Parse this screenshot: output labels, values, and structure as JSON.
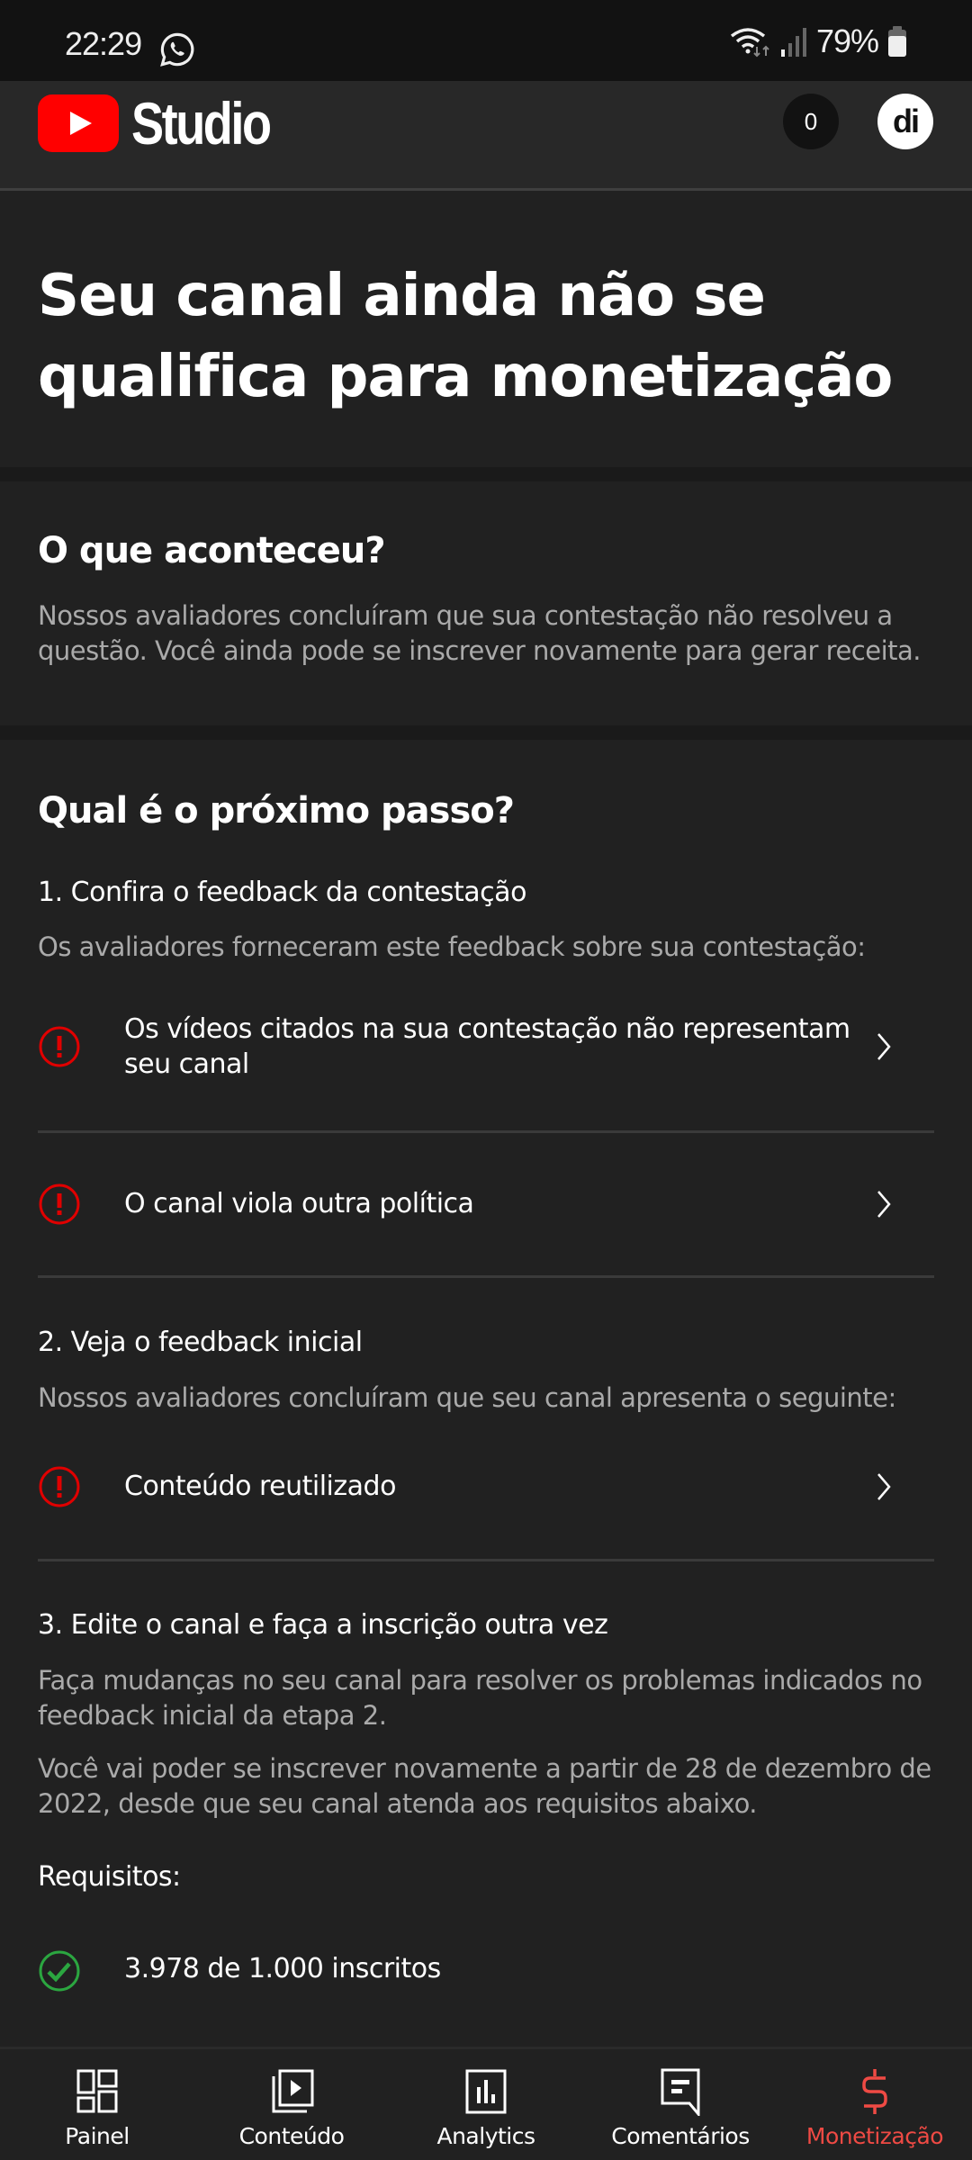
{
  "status_bar": {
    "time": "22:29",
    "notification_icon": "whatsapp-icon",
    "battery_percent": "79%",
    "icons": [
      "wifi-icon",
      "signal-icon",
      "battery-icon"
    ]
  },
  "header": {
    "app_name": "Studio",
    "logo_icon": "youtube-logo-icon",
    "notification_count": "0",
    "avatar_text": "di"
  },
  "title_section": {
    "title": "Seu canal ainda não se qualifica para monetização"
  },
  "what_happened": {
    "heading": "O que aconteceu?",
    "body": "Nossos avaliadores concluíram que sua contestação não resolveu a questão. Você ainda pode se inscrever novamente para gerar receita."
  },
  "next_step": {
    "heading": "Qual é o próximo passo?",
    "step1": {
      "title": "1. Confira o feedback da contestação",
      "subtitle": "Os avaliadores forneceram este feedback sobre sua contestação:",
      "items": [
        {
          "icon": "alert-icon",
          "label": "Os vídeos citados na sua contestação não representam seu canal"
        },
        {
          "icon": "alert-icon",
          "label": "O canal viola outra política"
        }
      ]
    },
    "step2": {
      "title": "2. Veja o feedback inicial",
      "subtitle": "Nossos avaliadores concluíram que seu canal apresenta o seguinte:",
      "items": [
        {
          "icon": "alert-icon",
          "label": "Conteúdo reutilizado"
        }
      ]
    },
    "step3": {
      "title": "3. Edite o canal e faça a inscrição outra vez",
      "paragraph1": "Faça mudanças no seu canal para resolver os problemas indicados no feedback inicial da etapa 2.",
      "paragraph2": "Você vai poder se inscrever novamente a partir de 28 de dezembro de 2022, desde que seu canal atenda aos requisitos abaixo.",
      "requirements_label": "Requisitos:",
      "requirements": [
        {
          "icon": "check-circle-icon",
          "label": "3.978 de 1.000 inscritos",
          "met": true
        }
      ]
    }
  },
  "bottom_nav": {
    "items": [
      {
        "label": "Painel",
        "icon": "dashboard-icon",
        "active": false
      },
      {
        "label": "Conteúdo",
        "icon": "content-icon",
        "active": false
      },
      {
        "label": "Analytics",
        "icon": "analytics-icon",
        "active": false
      },
      {
        "label": "Comentários",
        "icon": "comments-icon",
        "active": false
      },
      {
        "label": "Monetização",
        "icon": "dollar-icon",
        "active": true
      }
    ]
  },
  "colors": {
    "background": "#212121",
    "header_background": "#282828",
    "status_bar_background": "#121212",
    "accent_red": "#ef4a44",
    "alert_red": "#e00000",
    "success_green": "#2ba640",
    "secondary_text": "#aaaaaa"
  }
}
